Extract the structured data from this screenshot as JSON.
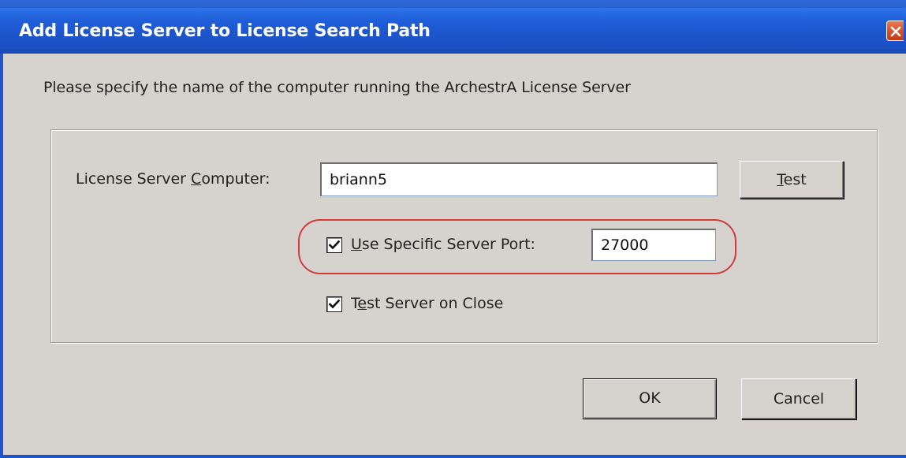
{
  "window": {
    "title": "Add License Server to License Search Path"
  },
  "dialog": {
    "prompt": "Please specify the name of the computer running the ArchestrA License Server",
    "computer_label_pre": "License Server ",
    "computer_label_accel": "C",
    "computer_label_post": "omputer:",
    "computer_value": "briann5",
    "test_button_accel": "T",
    "test_button_rest": "est",
    "port_checkbox_checked": true,
    "port_label_accel": "U",
    "port_label_rest": "se Specific Server Port:",
    "port_value": "27000",
    "test_on_close_checked": true,
    "test_on_close_pre": "T",
    "test_on_close_accel": "e",
    "test_on_close_post": "st Server on Close",
    "ok_label": "OK",
    "cancel_label": "Cancel"
  },
  "colors": {
    "titlebar": "#1f55c8",
    "dialog_face": "#d6d3ce",
    "highlight": "#d03b3b",
    "close_button": "#d8512c"
  },
  "icons": {
    "close": "close-icon",
    "check": "checkmark-icon"
  }
}
